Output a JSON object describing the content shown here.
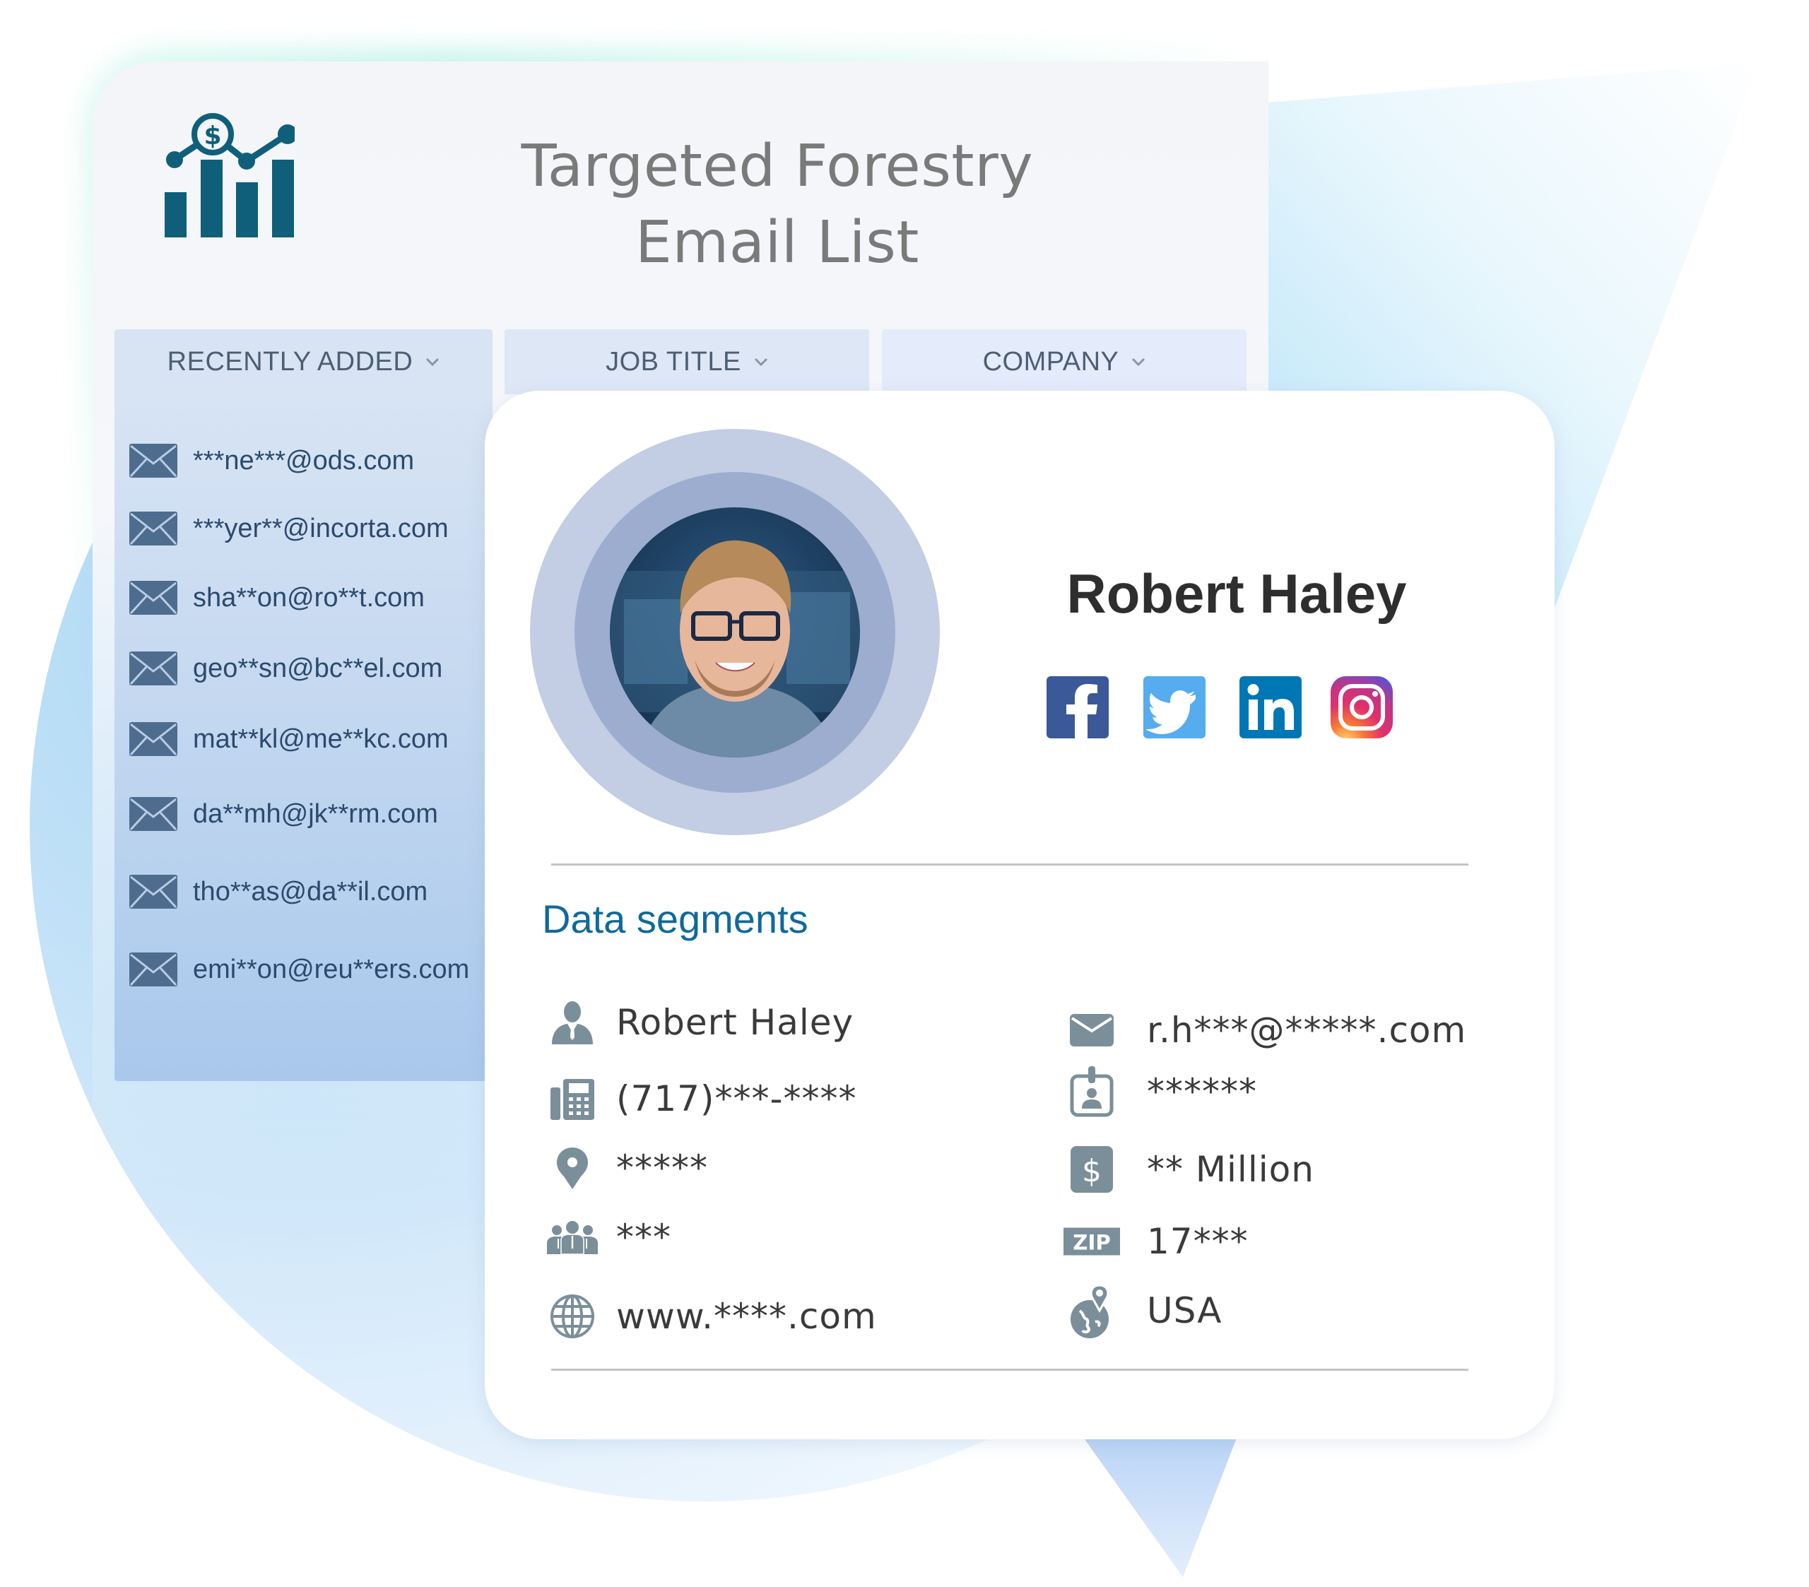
{
  "header": {
    "title_line1": "Targeted Forestry",
    "title_line2": "Email List",
    "logo_icon": "chart-dollar-icon"
  },
  "tabs": [
    {
      "label": "RECENTLY ADDED",
      "icon": "chevron-down-icon"
    },
    {
      "label": "JOB TITLE",
      "icon": "chevron-down-icon"
    },
    {
      "label": "COMPANY",
      "icon": "chevron-down-icon"
    }
  ],
  "email_list": [
    {
      "icon": "envelope-icon",
      "email": "***ne***@ods.com"
    },
    {
      "icon": "envelope-icon",
      "email": "***yer**@incorta.com"
    },
    {
      "icon": "envelope-icon",
      "email": "sha**on@ro**t.com"
    },
    {
      "icon": "envelope-icon",
      "email": "geo**sn@bc**el.com"
    },
    {
      "icon": "envelope-icon",
      "email": "mat**kl@me**kc.com"
    },
    {
      "icon": "envelope-icon",
      "email": "da**mh@jk**rm.com"
    },
    {
      "icon": "envelope-icon",
      "email": "tho**as@da**il.com"
    },
    {
      "icon": "envelope-icon",
      "email": "emi**on@reu**ers.com"
    }
  ],
  "profile": {
    "name": "Robert Haley",
    "avatar": "profile-photo",
    "social": [
      {
        "name": "Facebook",
        "icon": "facebook-icon",
        "color": "#3b5998"
      },
      {
        "name": "Twitter",
        "icon": "twitter-icon",
        "color": "#55acee"
      },
      {
        "name": "LinkedIn",
        "icon": "linkedin-icon",
        "color": "#0077b5"
      },
      {
        "name": "Instagram",
        "icon": "instagram-icon",
        "color": "#c13584"
      }
    ]
  },
  "segments": {
    "title": "Data segments",
    "left": [
      {
        "icon": "person-icon",
        "value": "Robert Haley"
      },
      {
        "icon": "phone-icon",
        "value": "(717)***-****"
      },
      {
        "icon": "location-pin-icon",
        "value": "*****"
      },
      {
        "icon": "team-icon",
        "value": "***"
      },
      {
        "icon": "globe-icon",
        "value": "www.****.com"
      }
    ],
    "right": [
      {
        "icon": "mail-icon",
        "value": "r.h***@*****.com"
      },
      {
        "icon": "id-badge-icon",
        "value": "******"
      },
      {
        "icon": "dollar-icon",
        "value": "** Million"
      },
      {
        "icon": "zip-icon",
        "value": "17***"
      },
      {
        "icon": "globe-location-icon",
        "value": "USA"
      }
    ]
  },
  "colors": {
    "brand_teal": "#0f5f7a",
    "segment_heading": "#0f6a9a",
    "icon_gray": "#7b8f9a",
    "email_text": "#2c4a6e"
  }
}
